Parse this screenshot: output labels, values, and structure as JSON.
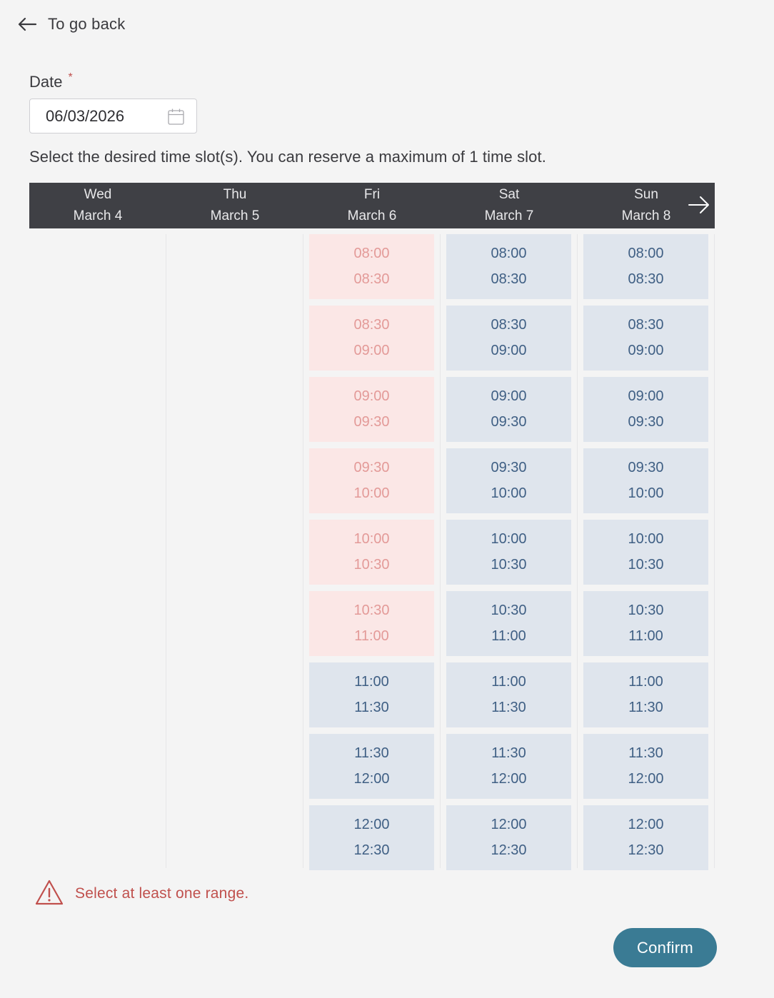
{
  "back": {
    "label": "To go back",
    "icon": "arrow-left-icon"
  },
  "date_field": {
    "label": "Date",
    "required_mark": "*",
    "value": "06/03/2026",
    "icon": "calendar-icon"
  },
  "instructions": "Select the desired time slot(s). You can reserve a maximum of 1 time slot.",
  "days": [
    {
      "weekday": "Wed",
      "date": "March 4"
    },
    {
      "weekday": "Thu",
      "date": "March 5"
    },
    {
      "weekday": "Fri",
      "date": "March 6"
    },
    {
      "weekday": "Sat",
      "date": "March 7"
    },
    {
      "weekday": "Sun",
      "date": "March 8"
    }
  ],
  "next_week_icon": "arrow-right-icon",
  "slots": {
    "fri": [
      {
        "start": "08:00",
        "end": "08:30",
        "status": "unavailable"
      },
      {
        "start": "08:30",
        "end": "09:00",
        "status": "unavailable"
      },
      {
        "start": "09:00",
        "end": "09:30",
        "status": "unavailable"
      },
      {
        "start": "09:30",
        "end": "10:00",
        "status": "unavailable"
      },
      {
        "start": "10:00",
        "end": "10:30",
        "status": "unavailable"
      },
      {
        "start": "10:30",
        "end": "11:00",
        "status": "unavailable"
      },
      {
        "start": "11:00",
        "end": "11:30",
        "status": "available"
      },
      {
        "start": "11:30",
        "end": "12:00",
        "status": "available"
      },
      {
        "start": "12:00",
        "end": "12:30",
        "status": "available"
      }
    ],
    "sat": [
      {
        "start": "08:00",
        "end": "08:30",
        "status": "available"
      },
      {
        "start": "08:30",
        "end": "09:00",
        "status": "available"
      },
      {
        "start": "09:00",
        "end": "09:30",
        "status": "available"
      },
      {
        "start": "09:30",
        "end": "10:00",
        "status": "available"
      },
      {
        "start": "10:00",
        "end": "10:30",
        "status": "available"
      },
      {
        "start": "10:30",
        "end": "11:00",
        "status": "available"
      },
      {
        "start": "11:00",
        "end": "11:30",
        "status": "available"
      },
      {
        "start": "11:30",
        "end": "12:00",
        "status": "available"
      },
      {
        "start": "12:00",
        "end": "12:30",
        "status": "available"
      }
    ],
    "sun": [
      {
        "start": "08:00",
        "end": "08:30",
        "status": "available"
      },
      {
        "start": "08:30",
        "end": "09:00",
        "status": "available"
      },
      {
        "start": "09:00",
        "end": "09:30",
        "status": "available"
      },
      {
        "start": "09:30",
        "end": "10:00",
        "status": "available"
      },
      {
        "start": "10:00",
        "end": "10:30",
        "status": "available"
      },
      {
        "start": "10:30",
        "end": "11:00",
        "status": "available"
      },
      {
        "start": "11:00",
        "end": "11:30",
        "status": "available"
      },
      {
        "start": "11:30",
        "end": "12:00",
        "status": "available"
      },
      {
        "start": "12:00",
        "end": "12:30",
        "status": "available"
      }
    ]
  },
  "error": {
    "message": "Select at least one range.",
    "icon": "warning-triangle-icon"
  },
  "confirm_label": "Confirm",
  "colors": {
    "header_bg": "#3f4045",
    "slot_available_bg": "#dfe5ed",
    "slot_available_text": "#3f5f84",
    "slot_unavailable_bg": "#fbe7e6",
    "slot_unavailable_text": "#e39a98",
    "error": "#c0504d",
    "confirm_bg": "#3a7b94"
  }
}
